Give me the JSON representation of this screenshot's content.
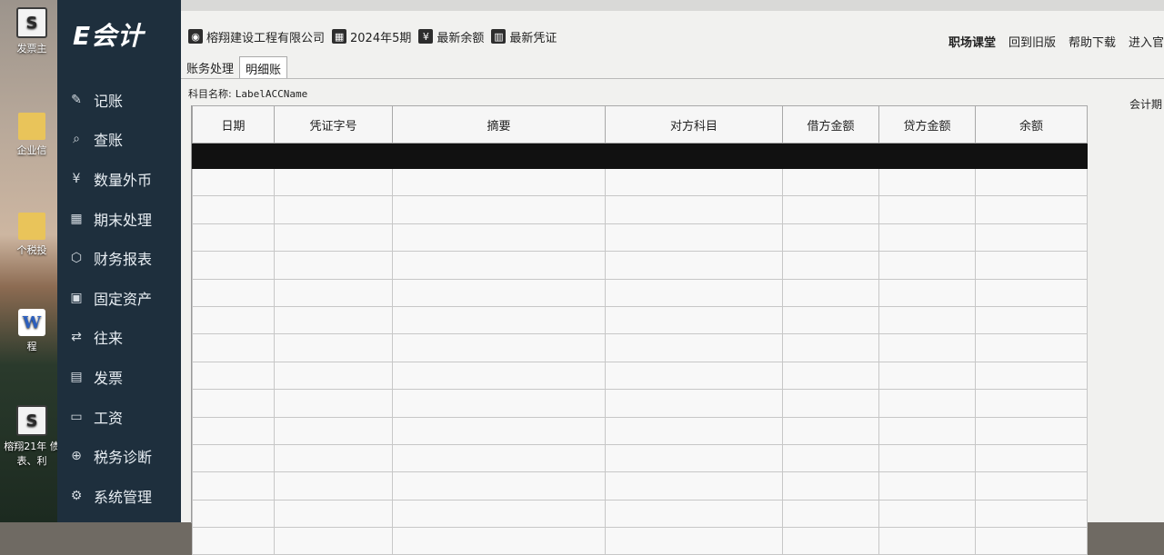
{
  "desktop": {
    "icons": [
      {
        "label": "发票主",
        "icon": "s-sheet-icon"
      },
      {
        "label": "企业信",
        "icon": "folder-icon"
      },
      {
        "label": "个税投",
        "icon": "folder-icon"
      },
      {
        "label": "程",
        "icon": "word-doc-icon"
      },
      {
        "label": "榕翔21年 债表、利",
        "icon": "s-sheet-icon"
      }
    ]
  },
  "app": {
    "logo": "E会计",
    "nav": [
      {
        "label": "记账",
        "icon": "pen-paper-icon"
      },
      {
        "label": "查账",
        "icon": "search-doc-icon"
      },
      {
        "label": "数量外币",
        "icon": "coin-icon"
      },
      {
        "label": "期末处理",
        "icon": "calendar-icon"
      },
      {
        "label": "财务报表",
        "icon": "report-icon"
      },
      {
        "label": "固定资产",
        "icon": "asset-icon"
      },
      {
        "label": "往来",
        "icon": "exchange-icon"
      },
      {
        "label": "发票",
        "icon": "invoice-icon"
      },
      {
        "label": "工资",
        "icon": "wallet-icon"
      },
      {
        "label": "税务诊断",
        "icon": "medical-icon"
      },
      {
        "label": "系统管理",
        "icon": "gear-icon"
      }
    ]
  },
  "toolbar": {
    "company": "榕翔建设工程有限公司",
    "period": "2024年5期",
    "balance": "最新余额",
    "voucher": "最新凭证"
  },
  "header_links": {
    "course": "职场课堂",
    "old_version": "回到旧版",
    "download": "帮助下载",
    "enter": "进入官"
  },
  "tabs": [
    "账务处理",
    "明细账"
  ],
  "subject_label": "科目名称:",
  "subject_value": "LabelACCName",
  "period_label": "会计期",
  "table": {
    "columns": [
      "日期",
      "凭证字号",
      "摘要",
      "对方科目",
      "借方金额",
      "贷方金额",
      "余额"
    ]
  }
}
